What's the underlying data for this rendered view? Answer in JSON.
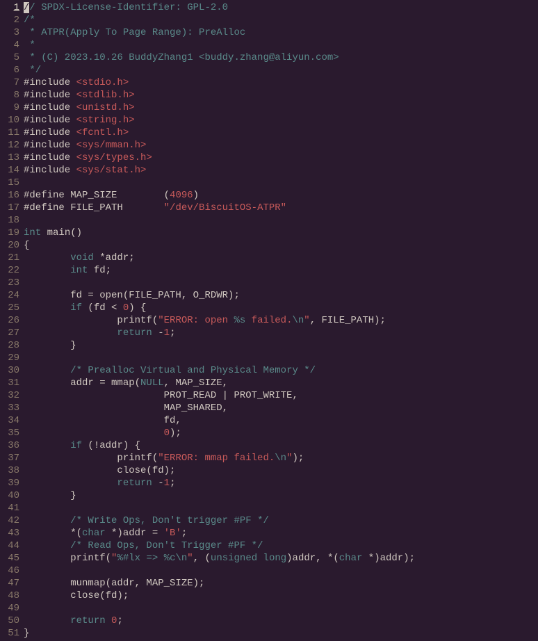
{
  "lines": [
    [
      [
        "cursor",
        "/"
      ],
      [
        "comment",
        "/ SPDX-License-Identifier: GPL-2.0"
      ]
    ],
    [
      [
        "comment",
        "/*"
      ]
    ],
    [
      [
        "comment",
        " * ATPR(Apply To Page Range): PreAlloc"
      ]
    ],
    [
      [
        "comment",
        " *"
      ]
    ],
    [
      [
        "comment",
        " * (C) 2023.10.26 BuddyZhang1 <buddy.zhang@aliyun.com>"
      ]
    ],
    [
      [
        "comment",
        " */"
      ]
    ],
    [
      [
        "pp",
        "#include "
      ],
      [
        "string",
        "<stdio.h>"
      ]
    ],
    [
      [
        "pp",
        "#include "
      ],
      [
        "string",
        "<stdlib.h>"
      ]
    ],
    [
      [
        "pp",
        "#include "
      ],
      [
        "string",
        "<unistd.h>"
      ]
    ],
    [
      [
        "pp",
        "#include "
      ],
      [
        "string",
        "<string.h>"
      ]
    ],
    [
      [
        "pp",
        "#include "
      ],
      [
        "string",
        "<fcntl.h>"
      ]
    ],
    [
      [
        "pp",
        "#include "
      ],
      [
        "string",
        "<sys/mman.h>"
      ]
    ],
    [
      [
        "pp",
        "#include "
      ],
      [
        "string",
        "<sys/types.h>"
      ]
    ],
    [
      [
        "pp",
        "#include "
      ],
      [
        "string",
        "<sys/stat.h>"
      ]
    ],
    [
      [
        "plain",
        ""
      ]
    ],
    [
      [
        "pp",
        "#define MAP_SIZE        ("
      ],
      [
        "number",
        "4096"
      ],
      [
        "pp",
        ")"
      ]
    ],
    [
      [
        "pp",
        "#define FILE_PATH       "
      ],
      [
        "string",
        "\"/dev/BiscuitOS-ATPR\""
      ]
    ],
    [
      [
        "plain",
        ""
      ]
    ],
    [
      [
        "type",
        "int"
      ],
      [
        "plain",
        " main()"
      ]
    ],
    [
      [
        "plain",
        "{"
      ]
    ],
    [
      [
        "plain",
        "        "
      ],
      [
        "type",
        "void"
      ],
      [
        "plain",
        " *addr;"
      ]
    ],
    [
      [
        "plain",
        "        "
      ],
      [
        "type",
        "int"
      ],
      [
        "plain",
        " fd;"
      ]
    ],
    [
      [
        "plain",
        ""
      ]
    ],
    [
      [
        "plain",
        "        fd = open(FILE_PATH, O_RDWR);"
      ]
    ],
    [
      [
        "plain",
        "        "
      ],
      [
        "keyword",
        "if"
      ],
      [
        "plain",
        " (fd < "
      ],
      [
        "number",
        "0"
      ],
      [
        "plain",
        ") {"
      ]
    ],
    [
      [
        "plain",
        "                printf("
      ],
      [
        "string",
        "\"ERROR: open "
      ],
      [
        "type",
        "%s"
      ],
      [
        "string",
        " failed."
      ],
      [
        "type",
        "\\n"
      ],
      [
        "string",
        "\""
      ],
      [
        "plain",
        ", FILE_PATH);"
      ]
    ],
    [
      [
        "plain",
        "                "
      ],
      [
        "keyword",
        "return"
      ],
      [
        "plain",
        " -"
      ],
      [
        "number",
        "1"
      ],
      [
        "plain",
        ";"
      ]
    ],
    [
      [
        "plain",
        "        }"
      ]
    ],
    [
      [
        "plain",
        ""
      ]
    ],
    [
      [
        "plain",
        "        "
      ],
      [
        "comment",
        "/* Prealloc Virtual and Physical Memory */"
      ]
    ],
    [
      [
        "plain",
        "        addr = mmap("
      ],
      [
        "type",
        "NULL"
      ],
      [
        "plain",
        ", MAP_SIZE,"
      ]
    ],
    [
      [
        "plain",
        "                        PROT_READ | PROT_WRITE,"
      ]
    ],
    [
      [
        "plain",
        "                        MAP_SHARED,"
      ]
    ],
    [
      [
        "plain",
        "                        fd,"
      ]
    ],
    [
      [
        "plain",
        "                        "
      ],
      [
        "number",
        "0"
      ],
      [
        "plain",
        ");"
      ]
    ],
    [
      [
        "plain",
        "        "
      ],
      [
        "keyword",
        "if"
      ],
      [
        "plain",
        " (!addr) {"
      ]
    ],
    [
      [
        "plain",
        "                printf("
      ],
      [
        "string",
        "\"ERROR: mmap failed."
      ],
      [
        "type",
        "\\n"
      ],
      [
        "string",
        "\""
      ],
      [
        "plain",
        ");"
      ]
    ],
    [
      [
        "plain",
        "                close(fd);"
      ]
    ],
    [
      [
        "plain",
        "                "
      ],
      [
        "keyword",
        "return"
      ],
      [
        "plain",
        " -"
      ],
      [
        "number",
        "1"
      ],
      [
        "plain",
        ";"
      ]
    ],
    [
      [
        "plain",
        "        }"
      ]
    ],
    [
      [
        "plain",
        ""
      ]
    ],
    [
      [
        "plain",
        "        "
      ],
      [
        "comment",
        "/* Write Ops, Don't trigger #PF */"
      ]
    ],
    [
      [
        "plain",
        "        *("
      ],
      [
        "type",
        "char"
      ],
      [
        "plain",
        " *)addr = "
      ],
      [
        "string",
        "'B'"
      ],
      [
        "plain",
        ";"
      ]
    ],
    [
      [
        "plain",
        "        "
      ],
      [
        "comment",
        "/* Read Ops, Don't Trigger #PF */"
      ]
    ],
    [
      [
        "plain",
        "        printf("
      ],
      [
        "string",
        "\""
      ],
      [
        "type",
        "%#lx"
      ],
      [
        "string",
        " "
      ],
      [
        "type",
        "=>"
      ],
      [
        "string",
        " "
      ],
      [
        "type",
        "%c"
      ],
      [
        "type",
        "\\n"
      ],
      [
        "string",
        "\""
      ],
      [
        "plain",
        ", ("
      ],
      [
        "type",
        "unsigned"
      ],
      [
        "plain",
        " "
      ],
      [
        "type",
        "long"
      ],
      [
        "plain",
        ")addr, *("
      ],
      [
        "type",
        "char"
      ],
      [
        "plain",
        " *)addr);"
      ]
    ],
    [
      [
        "plain",
        ""
      ]
    ],
    [
      [
        "plain",
        "        munmap(addr, MAP_SIZE);"
      ]
    ],
    [
      [
        "plain",
        "        close(fd);"
      ]
    ],
    [
      [
        "plain",
        ""
      ]
    ],
    [
      [
        "plain",
        "        "
      ],
      [
        "keyword",
        "return"
      ],
      [
        "plain",
        " "
      ],
      [
        "number",
        "0"
      ],
      [
        "plain",
        ";"
      ]
    ],
    [
      [
        "plain",
        "}"
      ]
    ]
  ],
  "current_line": 1
}
